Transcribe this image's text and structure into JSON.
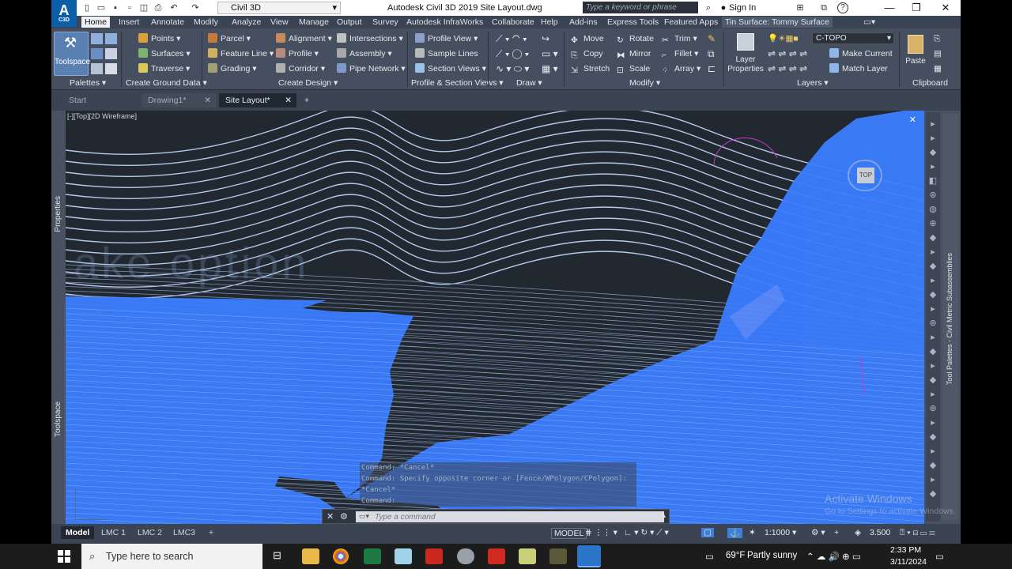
{
  "app": {
    "logo_letter": "A",
    "logo_sub": "C3D",
    "workspace": "Civil 3D",
    "title": "Autodesk Civil 3D 2019    Site Layout.dwg",
    "search_placeholder": "Type a keyword or phrase",
    "signin": "Sign In",
    "help": "?",
    "min": "—",
    "restore": "❐",
    "close": "✕"
  },
  "menu_tabs": [
    "Home",
    "Insert",
    "Annotate",
    "Modify",
    "Analyze",
    "View",
    "Manage",
    "Output",
    "Survey",
    "Autodesk InfraWorks",
    "Collaborate",
    "Help",
    "Add-ins",
    "Express Tools",
    "Featured Apps",
    "Tin Surface: Tommy Surface"
  ],
  "ribbon": {
    "toolspace": "Toolspace",
    "palettes_label": "Palettes",
    "create_ground": [
      "Points",
      "Surfaces",
      "Traverse"
    ],
    "create_ground_label": "Create Ground Data",
    "create_design_a": [
      "Parcel",
      "Feature Line",
      "Grading"
    ],
    "create_design_b": [
      "Alignment",
      "Profile",
      "Corridor"
    ],
    "create_design_c": [
      "Intersections",
      "Assembly",
      "Pipe Network"
    ],
    "create_design_label": "Create Design",
    "profile_section": [
      "Profile View",
      "Sample Lines",
      "Section Views"
    ],
    "profile_section_label": "Profile & Section Views",
    "draw_label": "Draw",
    "modify_a": [
      "Move",
      "Copy",
      "Stretch"
    ],
    "modify_b": [
      "Rotate",
      "Mirror",
      "Scale"
    ],
    "modify_c": [
      "Trim",
      "Fillet",
      "Array"
    ],
    "modify_label": "Modify",
    "layer_properties": "Layer Properties",
    "layer_current": "C-TOPO",
    "make_current": "Make Current",
    "match_layer": "Match Layer",
    "layers_label": "Layers",
    "paste": "Paste",
    "clipboard_label": "Clipboard"
  },
  "doc_tabs": [
    "Start",
    "Drawing1*",
    "Site Layout*"
  ],
  "viewport_label": "[-][Top][2D Wireframe]",
  "viewcube": "TOP",
  "left_palettes": [
    "Properties",
    "Toolspace"
  ],
  "right_palette": "Tool Palettes - Civil Metric Subassemblies",
  "canvas_ghost_text": "ake  option",
  "command_history": [
    "Command: *Cancel*",
    "Command: Specify opposite corner or [Fence/WPolygon/CPolygon]:",
    "*Cancel*",
    "Command:"
  ],
  "command_placeholder": "Type a command",
  "layout_tabs": [
    "Model",
    "LMC 1",
    "LMC 2",
    "LMC3"
  ],
  "status": {
    "model": "MODEL",
    "scale": "1:1000",
    "value": "3.500"
  },
  "watermark": {
    "line1": "Activate Windows",
    "line2": "Go to Settings to activate Windows."
  },
  "taskbar": {
    "search_placeholder": "Type here to search",
    "weather_temp": "69°F",
    "weather_desc": "Partly sunny",
    "time": "2:33 PM",
    "date": "3/11/2024"
  },
  "colors": {
    "accent": "#1f6fff",
    "canvas": "#212830",
    "surface": "#3e7eff",
    "ribbon": "#464f5f"
  }
}
